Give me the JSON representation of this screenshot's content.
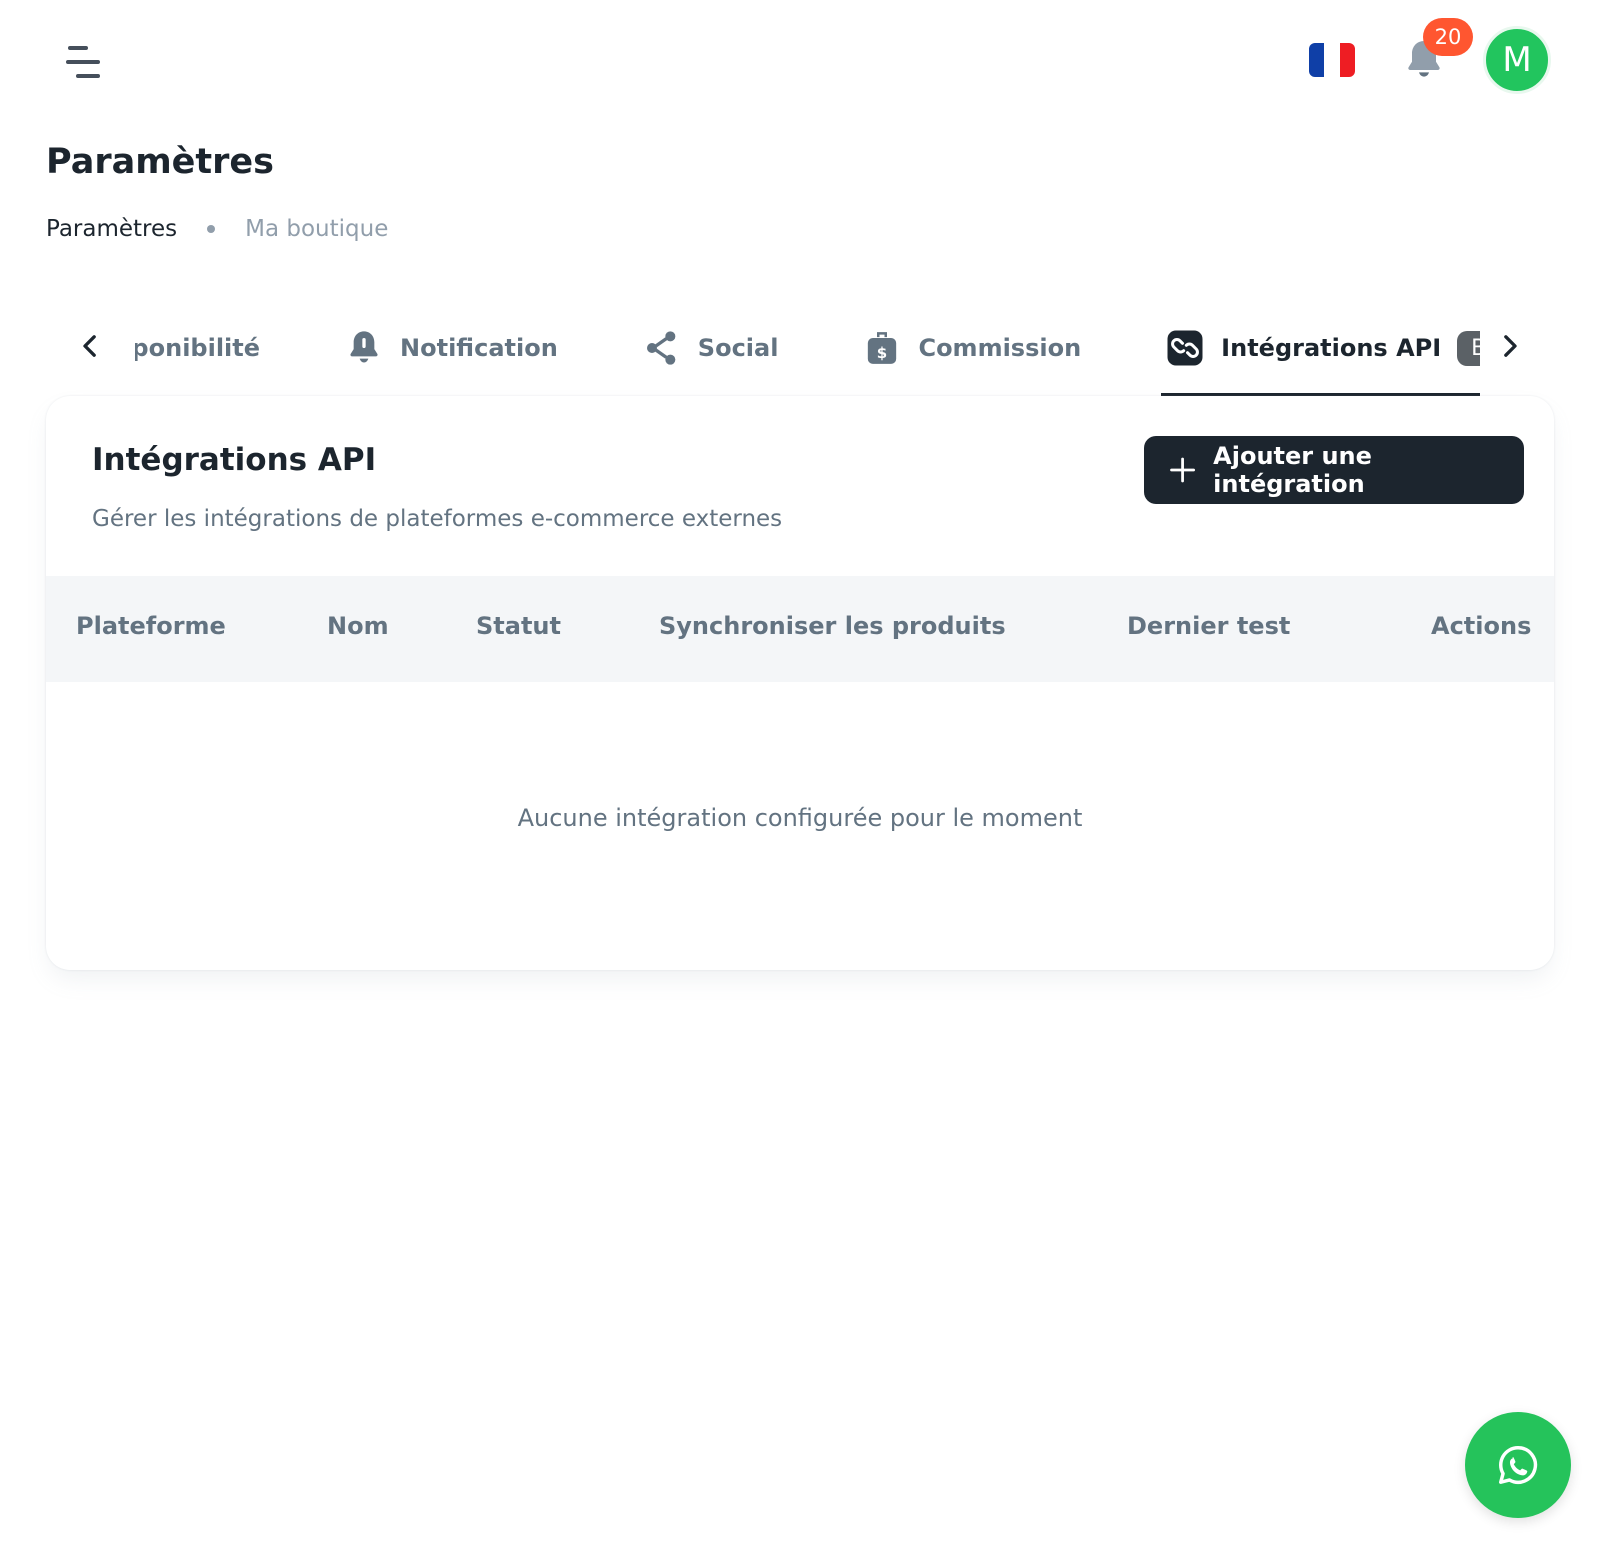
{
  "header": {
    "notification_count": "20",
    "avatar_initial": "M",
    "flag_colors": [
      "#0f3fa7",
      "#ffffff",
      "#ee1d23"
    ]
  },
  "page": {
    "title": "Paramètres",
    "breadcrumb": {
      "root": "Paramètres",
      "current": "Ma boutique"
    }
  },
  "tabs": {
    "items": [
      {
        "label": "Disponibilité",
        "icon": "availability-icon"
      },
      {
        "label": "Notification",
        "icon": "bell-icon"
      },
      {
        "label": "Social",
        "icon": "share-icon"
      },
      {
        "label": "Commission",
        "icon": "money-bag-icon"
      },
      {
        "label": "Intégrations API",
        "icon": "link-icon",
        "badge": "Beta",
        "active": true
      }
    ]
  },
  "card": {
    "title": "Intégrations API",
    "subtitle": "Gérer les intégrations de plateformes e-commerce externes",
    "add_button_label": "Ajouter une intégration",
    "columns": [
      "Plateforme",
      "Nom",
      "Statut",
      "Synchroniser les produits",
      "Dernier test",
      "Actions"
    ],
    "empty_message": "Aucune intégration configurée pour le moment"
  },
  "colors": {
    "primary_dark": "#1c252e",
    "muted_text": "#637381",
    "badge_red": "#ff5630",
    "avatar_green": "#22c55e",
    "whatsapp_green": "#25c35b"
  }
}
